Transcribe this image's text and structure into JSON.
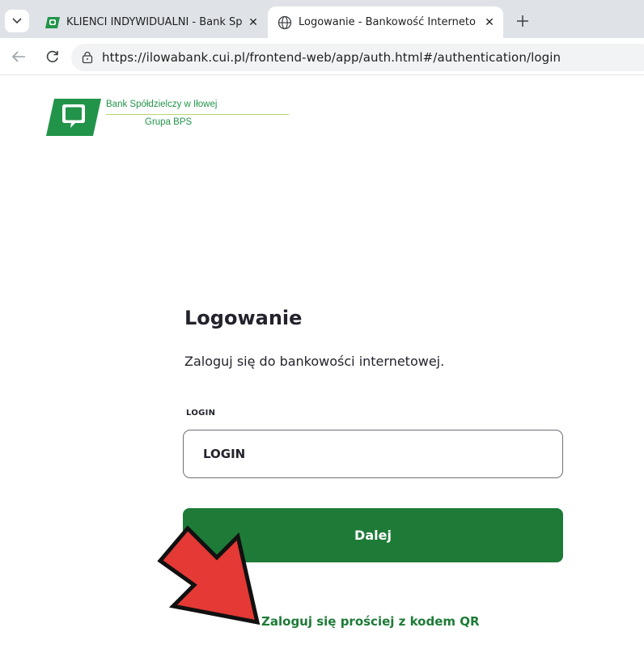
{
  "browser": {
    "tabs": [
      {
        "title": "KLIENCI INDYWIDUALNI - Bank Sp",
        "icon": "bank-favicon-icon",
        "active": false
      },
      {
        "title": "Logowanie - Bankowość Interneto",
        "icon": "globe-icon",
        "active": true
      }
    ],
    "url": "https://ilowabank.cui.pl/frontend-web/app/auth.html#/authentication/login"
  },
  "logo": {
    "line1": "Bank Spółdzielczy w Iłowej",
    "line2": "Grupa BPS"
  },
  "login": {
    "heading": "Logowanie",
    "subtitle": "Zaloguj się do bankowości internetowej.",
    "field_label": "LOGIN",
    "field_value": "LOGIN",
    "next_label": "Dalej",
    "qr_link": "Zaloguj się prościej z kodem QR"
  },
  "colors": {
    "brand_green": "#1e7b37",
    "logo_green": "#22944a",
    "annotation_arrow": "#e53935"
  }
}
